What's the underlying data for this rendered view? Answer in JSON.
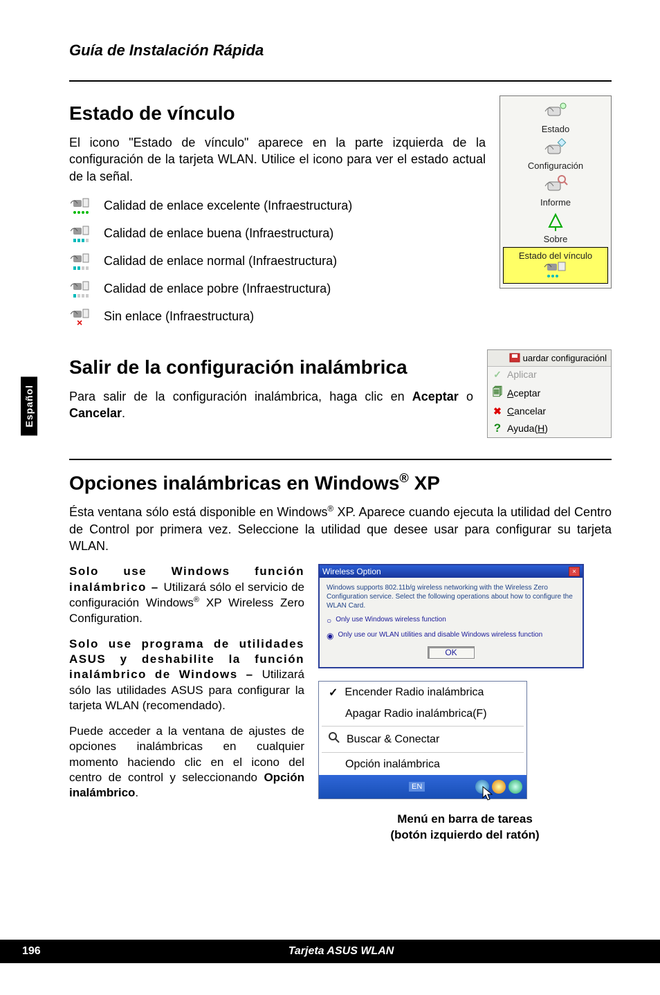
{
  "header": {
    "title": "Guía de Instalación Rápida"
  },
  "side_tab": "Español",
  "footer": {
    "page": "196",
    "title": "Tarjeta ASUS WLAN"
  },
  "section1": {
    "heading": "Estado de vínculo",
    "para": "El icono \"Estado de vínculo\" aparece en la parte izquierda de la configuración de la tarjeta WLAN. Utilice el icono para ver el estado actual de la señal.",
    "items": [
      "Calidad de enlace excelente (Infraestructura)",
      "Calidad de enlace buena (Infraestructura)",
      "Calidad de enlace normal (Infraestructura)",
      "Calidad de enlace pobre (Infraestructura)",
      "Sin enlace (Infraestructura)"
    ]
  },
  "sidebar": {
    "items": [
      "Estado",
      "Configuración",
      "Informe",
      "Sobre"
    ],
    "highlight": "Estado del vínculo"
  },
  "section2": {
    "heading": "Salir de la configuración inalámbrica",
    "para_pre": "Para salir de la configuración inalámbrica, haga clic en ",
    "bold1": "Aceptar",
    "mid": " o ",
    "bold2": "Cancelar",
    "suffix": "."
  },
  "menu_panel": {
    "title": "uardar configuraciónl",
    "items": [
      {
        "label": "Aplicar",
        "dim": true,
        "color": "#9aa",
        "glyph": "✓"
      },
      {
        "label": "Aceptar",
        "underline_index": 0,
        "color": "#0a0",
        "glyph": "🗐"
      },
      {
        "label": "Cancelar",
        "underline_index": 0,
        "color": "#d00",
        "glyph": "✖"
      },
      {
        "label": "Ayuda(H)",
        "underline_index": 6,
        "color": "#178a17",
        "glyph": "?"
      }
    ]
  },
  "section3": {
    "heading_pre": "Opciones inalámbricas en Windows",
    "heading_sup": "®",
    "heading_post": " XP",
    "para_pre": "Ésta ventana sólo está disponible en Windows",
    "para_sup": "®",
    "para_post": " XP. Aparece cuando ejecuta la utilidad del Centro de Control por primera vez. Seleccione la utilidad que desee usar para configurar su tarjeta WLAN.",
    "opt1_lead": "Solo use Windows función inalámbrico – ",
    "opt1_rest_pre": "Utilizará sólo el servicio de configuración Windows",
    "opt1_sup": "®",
    "opt1_rest_post": " XP Wireless Zero Configuration.",
    "opt2_lead": "Solo use programa de utilidades ASUS y deshabilite la función inalámbrico de Windows – ",
    "opt2_rest": "Utilizará sólo las utilidades ASUS para configurar la tarjeta WLAN (recomendado).",
    "para3_pre": "Puede acceder a la ventana de ajustes de opciones inalámbricas en cualquier momento haciendo clic en el icono del centro de control y seleccionando ",
    "para3_bold": "Opción inalámbrico",
    "para3_post": "."
  },
  "win_dialog": {
    "title": "Wireless Option",
    "desc": "Windows supports 802.11b/g wireless networking with the Wireless Zero Configuration service. Select the following operations about how to configure the WLAN Card.",
    "opt1": "Only use Windows wireless function",
    "opt2": "Only use our WLAN utilities and disable Windows wireless function",
    "ok": "OK"
  },
  "ctx_menu": {
    "items": [
      {
        "label": "Encender Radio inalámbrica",
        "check": true
      },
      {
        "label": "Apagar Radio inalámbrica(F)"
      },
      {
        "label": "Buscar & Conectar",
        "icon": "search"
      },
      {
        "label": "Opción inalámbrica"
      }
    ],
    "lang": "EN"
  },
  "caption": {
    "line1": "Menú en barra de tareas",
    "line2": "(botón izquierdo del ratón)"
  }
}
